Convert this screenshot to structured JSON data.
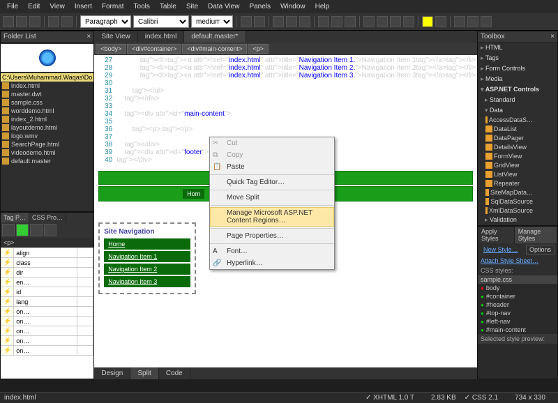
{
  "menu": [
    "File",
    "Edit",
    "View",
    "Insert",
    "Format",
    "Tools",
    "Table",
    "Site",
    "Data View",
    "Panels",
    "Window",
    "Help"
  ],
  "toolbar": {
    "style": "Paragraph",
    "font": "Calibri",
    "size": "medium"
  },
  "folder": {
    "title": "Folder List",
    "path": "C:\\Users\\Muhammad.Waqas\\Do",
    "files": [
      "index.html",
      "master.dwt",
      "sample.css",
      "worddemo.html",
      "index_2.html",
      "layoutdemo.html",
      "logo.wmv",
      "SearchPage.html",
      "videodemo.html",
      "default.master"
    ]
  },
  "tags": {
    "tabs": [
      "Tag P…",
      "CSS Pro…"
    ],
    "current": "<p>",
    "rows": [
      "align",
      "class",
      "dir",
      "en…",
      "id",
      "lang",
      "on…",
      "on…",
      "on…",
      "on…",
      "on…"
    ]
  },
  "docs": {
    "tabs": [
      "Site View",
      "index.html",
      "default.master*"
    ],
    "active": 2
  },
  "crumb": [
    "<body>",
    "<div#container>",
    "<div#main-content>",
    "<p>"
  ],
  "code": {
    "lines": [
      {
        "n": 27,
        "t": "            <li><a href=\"index.html\" title=\"Navigation Item 1.\">Navigation Item 1</a></li>"
      },
      {
        "n": 28,
        "t": "            <li><a href=\"index.html\" title=\"Navigation Item 2.\">Navigation Item 2</a></li>"
      },
      {
        "n": 29,
        "t": "            <li><a href=\"index.html\" title=\"Navigation Item 3.\">Navigation Item 3</a></li>"
      },
      {
        "n": 30,
        "t": ""
      },
      {
        "n": 31,
        "t": "        </ul>"
      },
      {
        "n": 32,
        "t": "    </div>"
      },
      {
        "n": 33,
        "t": ""
      },
      {
        "n": 34,
        "t": "    <div id=\"main-content\">"
      },
      {
        "n": 35,
        "t": ""
      },
      {
        "n": 36,
        "t": "        <p>&nbsp;</p>"
      },
      {
        "n": 37,
        "t": ""
      },
      {
        "n": 38,
        "t": "    </div>"
      },
      {
        "n": 39,
        "t": "    <div id=\"footer\"> </div>"
      },
      {
        "n": 40,
        "t": "</div>"
      }
    ]
  },
  "ctx": [
    {
      "label": "Cut",
      "dis": true,
      "ico": "✂"
    },
    {
      "label": "Copy",
      "dis": true,
      "ico": "⧉"
    },
    {
      "label": "Paste",
      "ico": "📋"
    },
    {
      "sep": true
    },
    {
      "label": "Quick Tag Editor…"
    },
    {
      "sep": true
    },
    {
      "label": "Move Split"
    },
    {
      "sep": true
    },
    {
      "label": "Manage Microsoft ASP.NET Content Regions…",
      "sel": true
    },
    {
      "sep": true
    },
    {
      "label": "Page Properties…"
    },
    {
      "sep": true
    },
    {
      "label": "Font…",
      "ico": "A"
    },
    {
      "label": "Hyperlink…",
      "ico": "🔗"
    }
  ],
  "design": {
    "home": "Hom",
    "nav_title": "Site Navigation",
    "nav_items": [
      "Home",
      "Navigation Item 1",
      "Navigation Item 2",
      "Navigation Item 3"
    ]
  },
  "views": [
    "Design",
    "Split",
    "Code"
  ],
  "toolbox": {
    "title": "Toolbox",
    "cats": [
      {
        "name": "HTML",
        "open": false
      },
      {
        "name": "Tags",
        "open": false
      },
      {
        "name": "Form Controls",
        "open": false
      },
      {
        "name": "Media",
        "open": false
      }
    ],
    "asp_hdr": "ASP.NET Controls",
    "asp": [
      {
        "name": "Standard",
        "open": false
      },
      {
        "name": "Data",
        "open": true,
        "items": [
          "AccessDataS…",
          "DataList",
          "DataPager",
          "DetailsView",
          "FormView",
          "GridView",
          "ListView",
          "Repeater",
          "SiteMapData…",
          "SqlDataSource",
          "XmlDataSource"
        ]
      },
      {
        "name": "Validation",
        "open": false
      }
    ]
  },
  "styles": {
    "tabs": [
      "Apply Styles",
      "Manage Styles"
    ],
    "new_link": "New Style…",
    "options": "Options",
    "attach": "Attach Style Sheet…",
    "hdr": "CSS styles:",
    "file": "sample.css",
    "rules": [
      "body",
      "#container",
      "#header",
      "#top-nav",
      "#left-nav",
      "#main-content"
    ],
    "preview_hdr": "Selected style preview:"
  },
  "status": {
    "file": "index.html",
    "xhtml": "XHTML 1.0 T",
    "size": "2.83 KB",
    "css": "CSS 2.1",
    "dim": "734 x 330"
  }
}
